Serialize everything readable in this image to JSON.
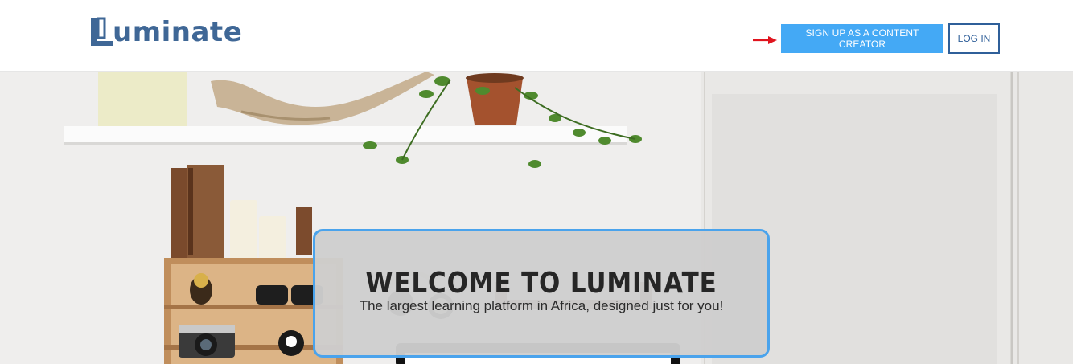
{
  "header": {
    "logo_text": "uminate",
    "signup_label": "SIGN UP AS A CONTENT CREATOR",
    "login_label": "LOG IN"
  },
  "hero": {
    "title": "WELCOME TO LUMINATE",
    "subtitle": "The largest learning platform in Africa, designed just for you!"
  },
  "colors": {
    "brand": "#3f6796",
    "signup_bg": "#44a9f5",
    "login_border": "#2f5f99",
    "welcome_border": "#4aa3ec",
    "arrow": "#e0141e"
  },
  "icons": {
    "logo": "luminate-logo-mark-icon",
    "arrow": "red-arrow-right-icon"
  }
}
